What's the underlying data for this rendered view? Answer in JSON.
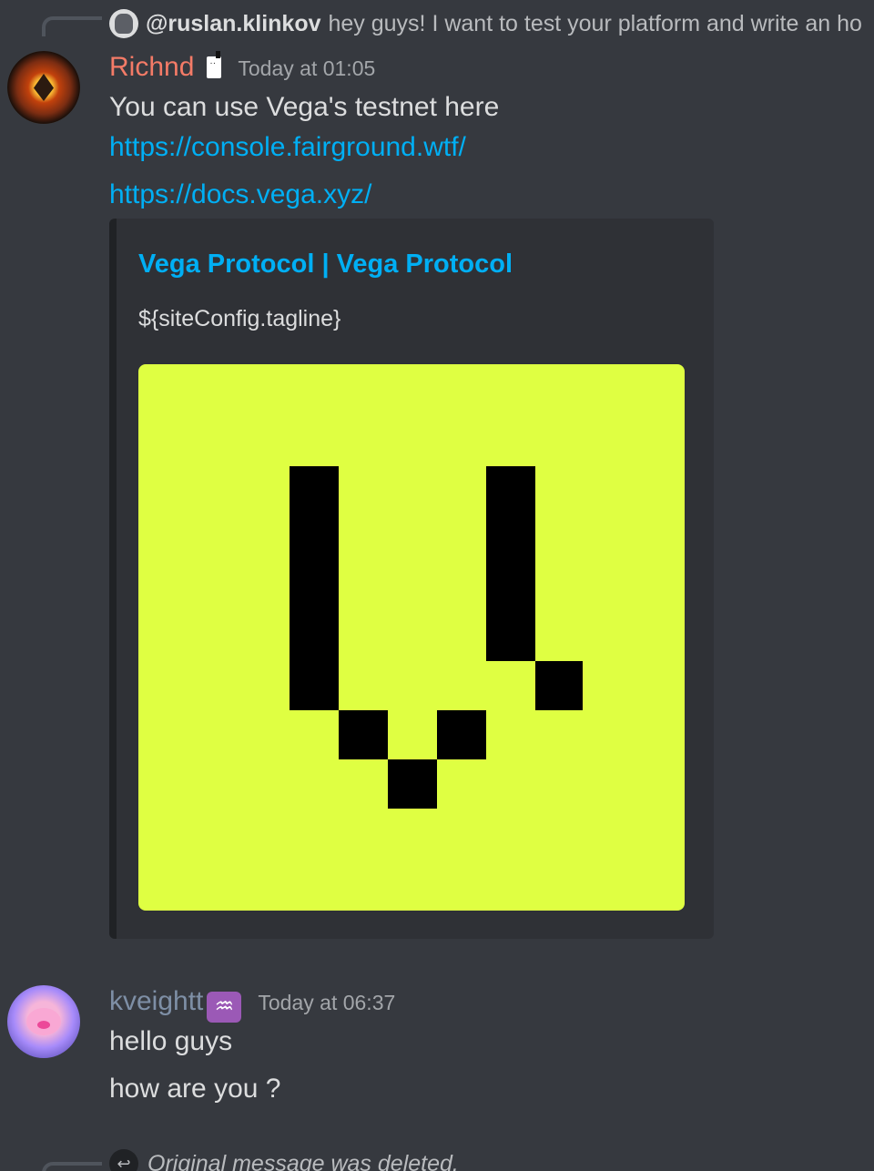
{
  "reply_top": {
    "username": "@ruslan.klinkov",
    "text": "hey guys! I want to test your platform and write an ho"
  },
  "message_richnd": {
    "username": "Richnd",
    "timestamp": "Today at 01:05",
    "text": "You can use Vega's testnet here",
    "link1": "https://console.fairground.wtf/",
    "link2": "https://docs.vega.xyz/",
    "embed": {
      "title": "Vega Protocol | Vega Protocol",
      "description": "${siteConfig.tagline}"
    }
  },
  "message_kveight": {
    "username": "kveightt",
    "badge": "♒",
    "timestamp": "Today at 06:37",
    "line1": "hello guys",
    "line2": "how are you ?"
  },
  "reply_bottom": {
    "text": "Original message was deleted."
  },
  "colors": {
    "background": "#36393f",
    "embed_bg": "#2f3136",
    "link": "#00aff4",
    "richnd_name": "#f47b67",
    "kveight_name": "#7e8fa6",
    "vega_yellow": "#dfff42"
  }
}
